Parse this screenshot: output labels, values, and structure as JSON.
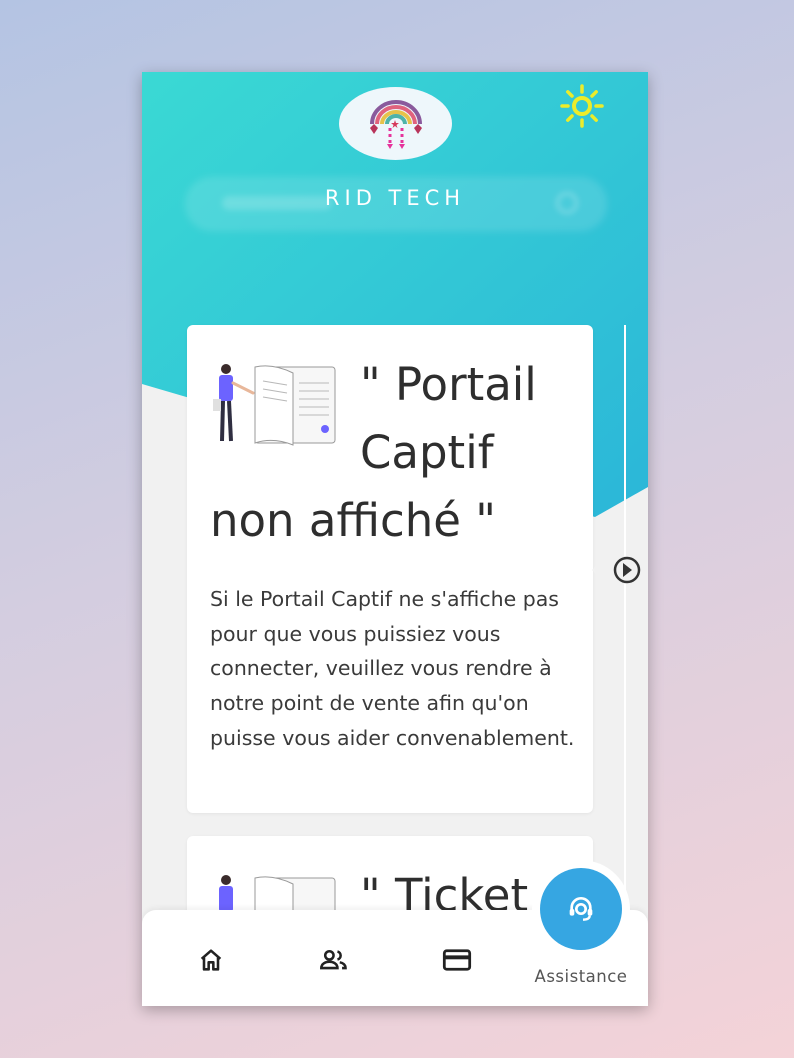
{
  "app": {
    "brand_name": "RID TECH",
    "theme_toggle_icon": "sun-icon"
  },
  "cards": [
    {
      "title": "\" Portail Captif non affiché \"",
      "body": "Si le Portail Captif ne s'affiche pas pour que vous puissiez vous connecter, veuillez vous rendre à notre point de vente afin qu'on puisse vous aider convenablement."
    },
    {
      "title": "\" Ticket"
    }
  ],
  "bottom_nav": {
    "items": [
      {
        "icon": "home-icon"
      },
      {
        "icon": "people-icon"
      },
      {
        "icon": "credit-card-icon"
      }
    ],
    "assistance_label": "Assistance",
    "assistance_icon": "support-agent-icon"
  },
  "colors": {
    "hero_gradient_start": "#3ad9d4",
    "hero_gradient_end": "#2bb6d8",
    "accent_blue": "#36a6e2",
    "sun_yellow": "#ecec2a"
  }
}
